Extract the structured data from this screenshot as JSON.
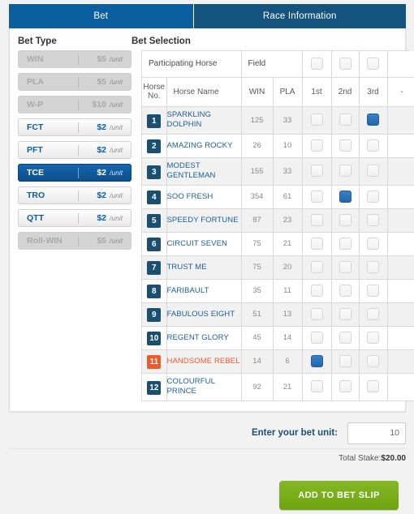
{
  "tabs": [
    {
      "label": "Bet",
      "active": true
    },
    {
      "label": "Race Information",
      "active": false
    }
  ],
  "sections": {
    "bet_type_title": "Bet Type",
    "bet_selection_title": "Bet Selection"
  },
  "bet_types": [
    {
      "code": "WIN",
      "price": "$5",
      "unit": "/unit",
      "state": "disabled"
    },
    {
      "code": "PLA",
      "price": "$5",
      "unit": "/unit",
      "state": "disabled"
    },
    {
      "code": "W-P",
      "price": "$10",
      "unit": "/unit",
      "state": "disabled"
    },
    {
      "code": "FCT",
      "price": "$2",
      "unit": "/unit",
      "state": "enabled"
    },
    {
      "code": "PFT",
      "price": "$2",
      "unit": "/unit",
      "state": "enabled"
    },
    {
      "code": "TCE",
      "price": "$2",
      "unit": "/unit",
      "state": "selected"
    },
    {
      "code": "TRO",
      "price": "$2",
      "unit": "/unit",
      "state": "enabled"
    },
    {
      "code": "QTT",
      "price": "$2",
      "unit": "/unit",
      "state": "enabled"
    },
    {
      "code": "Roll-WIN",
      "price": "$5",
      "unit": "/unit",
      "state": "disabled"
    }
  ],
  "table": {
    "group_headers": {
      "participating_horse": "Participating Horse",
      "field": "Field"
    },
    "field_row_checks": [
      false,
      false,
      false
    ],
    "columns": {
      "horse_no": "Horse No.",
      "horse_no_line1": "Horse",
      "horse_no_line2": "No.",
      "horse_name": "Horse Name",
      "win": "WIN",
      "pla": "PLA",
      "p1": "1st",
      "p2": "2nd",
      "p3": "3rd",
      "dash": "-"
    },
    "rows": [
      {
        "no": "1",
        "name": "SPARKLING DOLPHIN",
        "win": "125",
        "pla": "33",
        "checks": [
          false,
          false,
          true
        ],
        "highlight": false,
        "tall": true
      },
      {
        "no": "2",
        "name": "AMAZING ROCKY",
        "win": "26",
        "pla": "10",
        "checks": [
          false,
          false,
          false
        ],
        "highlight": false,
        "tall": false
      },
      {
        "no": "3",
        "name": "MODEST GENTLEMAN",
        "win": "155",
        "pla": "33",
        "checks": [
          false,
          false,
          false
        ],
        "highlight": false,
        "tall": true
      },
      {
        "no": "4",
        "name": "SOO FRESH",
        "win": "354",
        "pla": "61",
        "checks": [
          false,
          true,
          false
        ],
        "highlight": false,
        "tall": false
      },
      {
        "no": "5",
        "name": "SPEEDY FORTUNE",
        "win": "87",
        "pla": "23",
        "checks": [
          false,
          false,
          false
        ],
        "highlight": false,
        "tall": false
      },
      {
        "no": "6",
        "name": "CIRCUIT SEVEN",
        "win": "75",
        "pla": "21",
        "checks": [
          false,
          false,
          false
        ],
        "highlight": false,
        "tall": false
      },
      {
        "no": "7",
        "name": "TRUST ME",
        "win": "75",
        "pla": "20",
        "checks": [
          false,
          false,
          false
        ],
        "highlight": false,
        "tall": false
      },
      {
        "no": "8",
        "name": "FARIBAULT",
        "win": "35",
        "pla": "11",
        "checks": [
          false,
          false,
          false
        ],
        "highlight": false,
        "tall": false
      },
      {
        "no": "9",
        "name": "FABULOUS EIGHT",
        "win": "51",
        "pla": "13",
        "checks": [
          false,
          false,
          false
        ],
        "highlight": false,
        "tall": false
      },
      {
        "no": "10",
        "name": "REGENT GLORY",
        "win": "45",
        "pla": "14",
        "checks": [
          false,
          false,
          false
        ],
        "highlight": false,
        "tall": false
      },
      {
        "no": "11",
        "name": "HANDSOME REBEL",
        "win": "14",
        "pla": "6",
        "checks": [
          true,
          false,
          false
        ],
        "highlight": true,
        "tall": false
      },
      {
        "no": "12",
        "name": "COLOURFUL PRINCE",
        "win": "92",
        "pla": "21",
        "checks": [
          false,
          false,
          false
        ],
        "highlight": false,
        "tall": true
      }
    ]
  },
  "footer": {
    "unit_label": "Enter your bet unit:",
    "unit_value": "10",
    "unit_placeholder": "",
    "total_stake_label": "Total Stake:",
    "total_stake_value": "$20.00",
    "add_button": "ADD TO BET SLIP"
  },
  "colors": {
    "tab_active": "#0b5f9e",
    "tab_inactive": "#15537f",
    "selected_bettype": "#0d4e8c",
    "checkbox_checked": "#2165ad",
    "highlight_orange": "#ef5a2a",
    "badge_navy": "#1b4f72",
    "add_button_green": "#6fa30f"
  }
}
